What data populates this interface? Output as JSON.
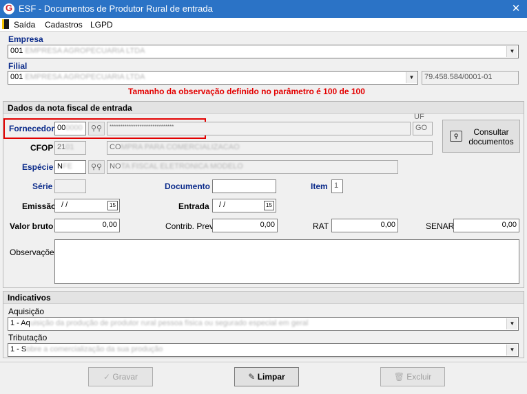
{
  "window": {
    "title": "ESF - Documentos de Produtor Rural de entrada",
    "app_icon_letter": "G",
    "close_glyph": "✕"
  },
  "menu": {
    "items": [
      "Saída",
      "Cadastros",
      "LGPD"
    ]
  },
  "empresa": {
    "label": "Empresa",
    "code": "001",
    "name_obscured": "EMPRESA AGROPECUARIA LTDA"
  },
  "filial": {
    "label": "Filial",
    "code": "001",
    "name_obscured": "EMPRESA AGROPECUARIA LTDA",
    "cnpj": "79.458.584/0001-01"
  },
  "warning": "Tamanho da observação definido no parâmetro é 100 de 100",
  "nota": {
    "header": "Dados da nota fiscal de entrada",
    "fornecedor": {
      "label": "Fornecedor",
      "code_visible": "00",
      "code_obscured": "0000",
      "name": "******************************"
    },
    "uf": {
      "label": "UF",
      "value": "GO"
    },
    "cfop": {
      "label": "CFOP",
      "code_visible": "21",
      "code_obscured": "01",
      "desc_visible": "CO",
      "desc_obscured": "MPRA PARA COMERCIALIZACAO"
    },
    "especie": {
      "label": "Espécie",
      "code_visible": "N",
      "code_obscured": "FE",
      "desc_visible": "NO",
      "desc_obscured": "TA FISCAL ELETRONICA MODELO"
    },
    "serie": {
      "label": "Série",
      "value": ""
    },
    "documento": {
      "label": "Documento",
      "value": ""
    },
    "item": {
      "label": "Item",
      "value": "1"
    },
    "emissao": {
      "label": "Emissão",
      "value": "/ /",
      "cal_day": "15"
    },
    "entrada": {
      "label": "Entrada",
      "value": "/ /",
      "cal_day": "15"
    },
    "valor_bruto": {
      "label": "Valor bruto",
      "value": "0,00"
    },
    "contrib_prev": {
      "label": "Contrib. Prev.",
      "value": "0,00"
    },
    "rat": {
      "label": "RAT",
      "value": "0,00"
    },
    "senar": {
      "label": "SENAR",
      "value": "0,00"
    },
    "observacoes": {
      "label": "Observações",
      "value": ""
    },
    "consultar_button": "Consultar\ndocumentos"
  },
  "indicativos": {
    "header": "Indicativos",
    "aquisicao": {
      "label": "Aquisição",
      "value_visible": "1 - Aq",
      "value_obscured": "uisição da produção de produtor rural pessoa física ou segurado especial em geral"
    },
    "tributacao": {
      "label": "Tributação",
      "value_visible": "1 - S",
      "value_obscured": "obre a comercialização da sua produção"
    }
  },
  "buttons": {
    "gravar": "Gravar",
    "limpar": "Limpar",
    "excluir": "Excluir"
  },
  "colors": {
    "titlebar": "#2b73c6",
    "label_blue": "#0a2a8a",
    "warning_red": "#e30000"
  },
  "icons": [
    "app-logo-icon",
    "close-icon",
    "exit-icon",
    "binoculars-icon",
    "calendar-icon",
    "search-documents-icon",
    "checkmark-icon",
    "broom-icon",
    "trash-icon",
    "chevron-down-icon"
  ]
}
